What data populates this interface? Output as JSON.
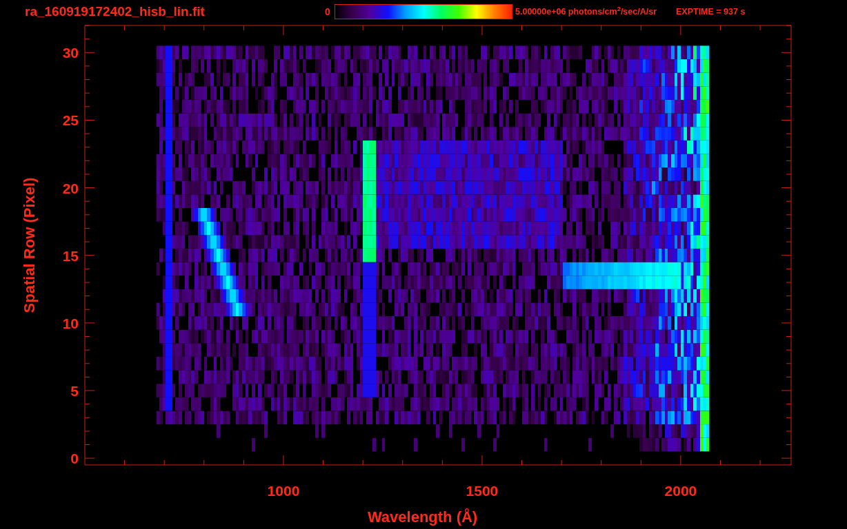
{
  "header": {
    "title": "ra_160919172402_hisb_lin.fit",
    "colorbar_min": "0",
    "colorbar_max": "5.00000e+06 photons/cm$^{2}$/sec/A/sr",
    "exposure": "EXPTIME = 937 s"
  },
  "plot": {
    "xlabel": "Wavelength (Å)",
    "ylabel": "Spatial Row (Pixel)",
    "xticks": [
      "1000",
      "1500",
      "2000"
    ],
    "yticks": [
      "30",
      "25",
      "20",
      "15",
      "10",
      "5",
      "0"
    ]
  }
}
